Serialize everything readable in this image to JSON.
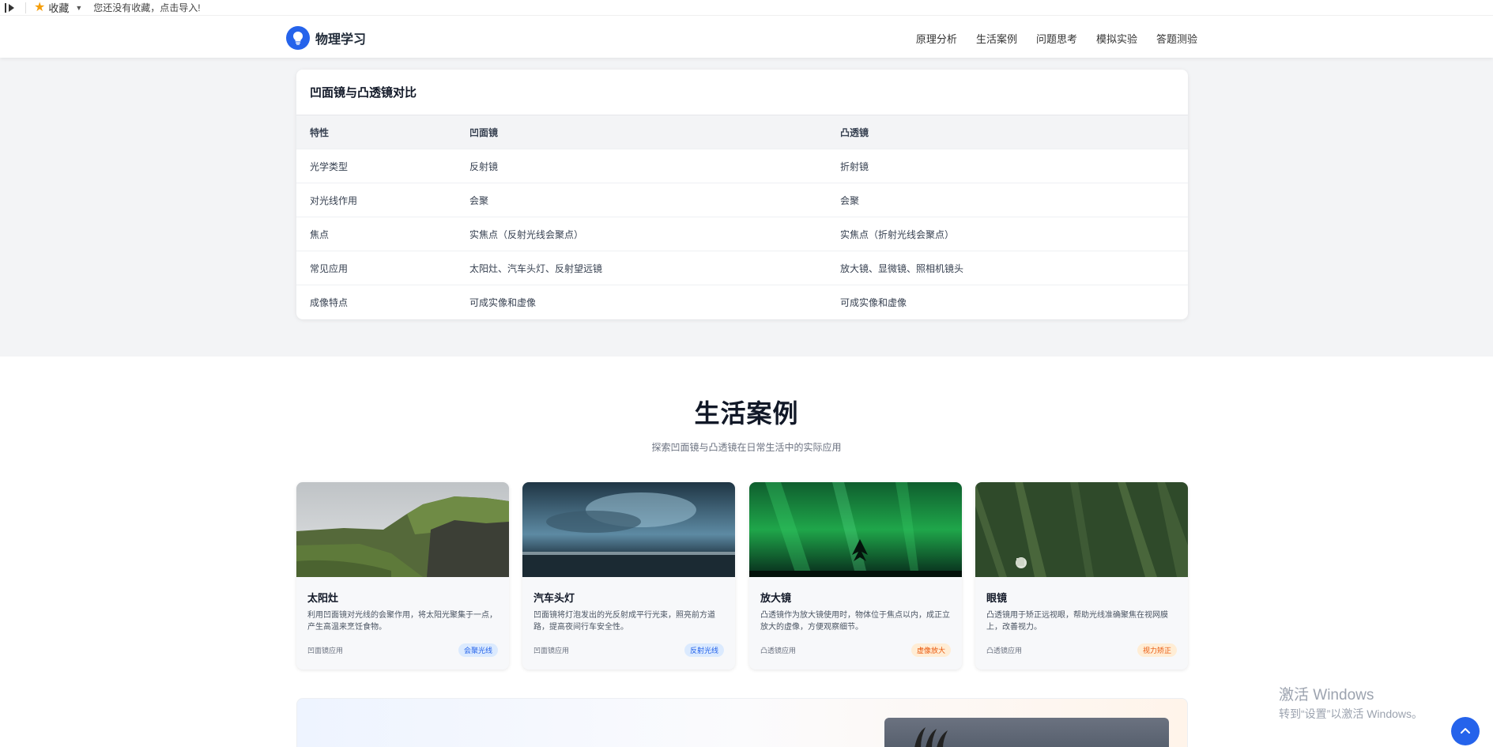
{
  "bookmark_bar": {
    "fav_label": "收藏",
    "hint": "您还没有收藏，点击导入!"
  },
  "nav": {
    "brand": "物理学习",
    "links": [
      "原理分析",
      "生活案例",
      "问题思考",
      "模拟实验",
      "答题测验"
    ]
  },
  "comparison": {
    "title": "凹面镜与凸透镜对比",
    "headers": [
      "特性",
      "凹面镜",
      "凸透镜"
    ],
    "rows": [
      [
        "光学类型",
        "反射镜",
        "折射镜"
      ],
      [
        "对光线作用",
        "会聚",
        "会聚"
      ],
      [
        "焦点",
        "实焦点（反射光线会聚点）",
        "实焦点（折射光线会聚点）"
      ],
      [
        "常见应用",
        "太阳灶、汽车头灯、反射望远镜",
        "放大镜、显微镜、照相机镜头"
      ],
      [
        "成像特点",
        "可成实像和虚像",
        "可成实像和虚像"
      ]
    ]
  },
  "cases": {
    "title": "生活案例",
    "subtitle": "探索凹面镜与凸透镜在日常生活中的实际应用",
    "cards": [
      {
        "title": "太阳灶",
        "desc": "利用凹面镜对光线的会聚作用，将太阳光聚集于一点，产生高温来烹饪食物。",
        "category": "凹面镜应用",
        "tag": "会聚光线"
      },
      {
        "title": "汽车头灯",
        "desc": "凹面镜将灯泡发出的光反射成平行光束，照亮前方道路，提高夜间行车安全性。",
        "category": "凹面镜应用",
        "tag": "反射光线"
      },
      {
        "title": "放大镜",
        "desc": "凸透镜作为放大镜使用时，物体位于焦点以内，成正立放大的虚像，方便观察细节。",
        "category": "凸透镜应用",
        "tag": "虚像放大"
      },
      {
        "title": "眼镜",
        "desc": "凸透镜用于矫正远视眼，帮助光线准确聚焦在视网膜上，改善视力。",
        "category": "凸透镜应用",
        "tag": "视力矫正"
      }
    ]
  },
  "watermark": {
    "line1": "激活 Windows",
    "line2": "转到“设置”以激活 Windows。"
  },
  "colors": {
    "accent": "#2563eb",
    "tag_blue_bg": "#dbeafe",
    "tag_orange_bg": "#ffedd5"
  }
}
